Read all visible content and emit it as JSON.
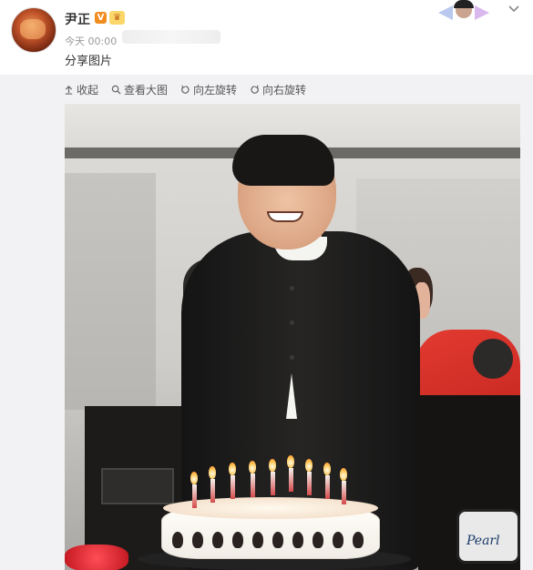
{
  "post": {
    "author": {
      "name": "尹正",
      "verified_badge": "V"
    },
    "time": "今天 00:00",
    "text": "分享图片"
  },
  "toolbar": {
    "collapse_label": "收起",
    "view_large_label": "查看大图",
    "rotate_left_label": "向左旋转",
    "rotate_right_label": "向右旋转"
  },
  "photo": {
    "drum_text": "Pearl"
  },
  "icons": {
    "header": [
      "avatar",
      "verified-icon",
      "crown-icon",
      "card-decoration",
      "chevron-down-icon"
    ],
    "toolbar": [
      "collapse-icon",
      "search-icon",
      "rotate-left-icon",
      "rotate-right-icon"
    ]
  },
  "colors": {
    "media_background": "#f2f2f5",
    "verified_badge": "#f28c1e",
    "text_primary": "#333333",
    "text_secondary": "#999999"
  }
}
